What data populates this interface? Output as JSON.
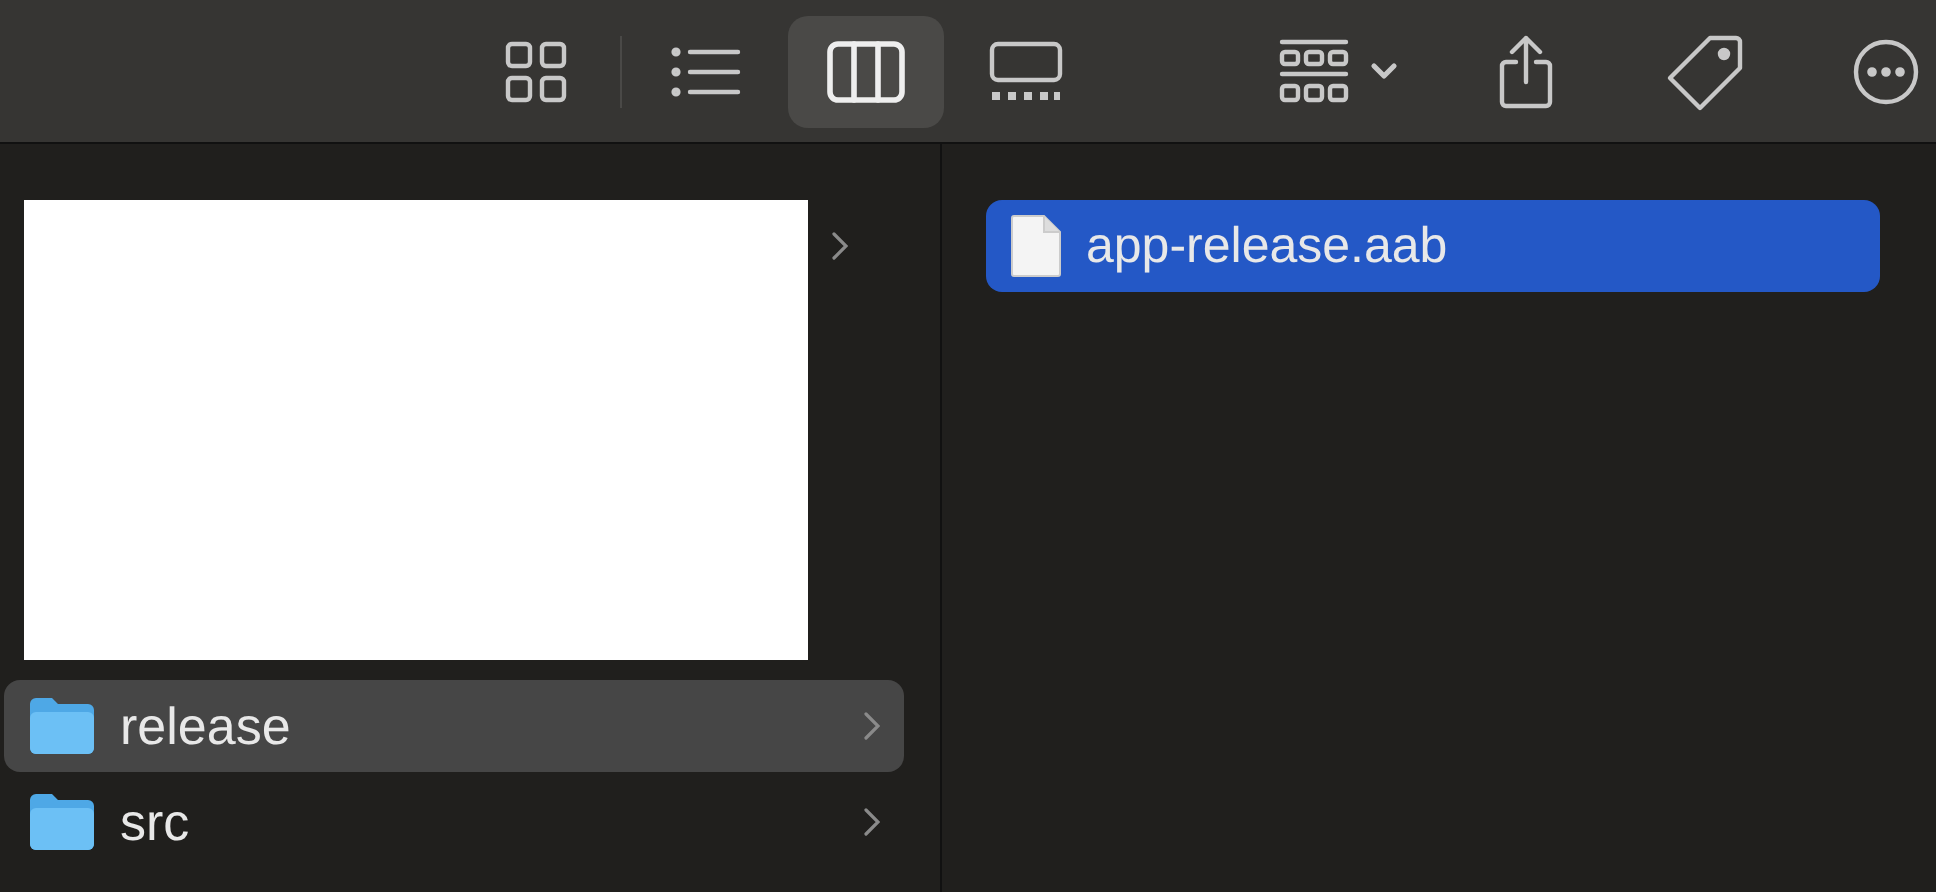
{
  "toolbar": {
    "view_modes": [
      {
        "kind": "icons",
        "selected": false
      },
      {
        "kind": "list",
        "selected": false
      },
      {
        "kind": "columns",
        "selected": true
      },
      {
        "kind": "gallery",
        "selected": false
      }
    ]
  },
  "columns": [
    {
      "rows": [
        {
          "kind": "blank",
          "selected": false
        },
        {
          "kind": "folder",
          "name": "release",
          "selected": true
        },
        {
          "kind": "folder",
          "name": "src",
          "selected": false
        }
      ]
    },
    {
      "rows": [
        {
          "kind": "file",
          "name": "app-release.aab",
          "selected": true
        }
      ]
    }
  ]
}
